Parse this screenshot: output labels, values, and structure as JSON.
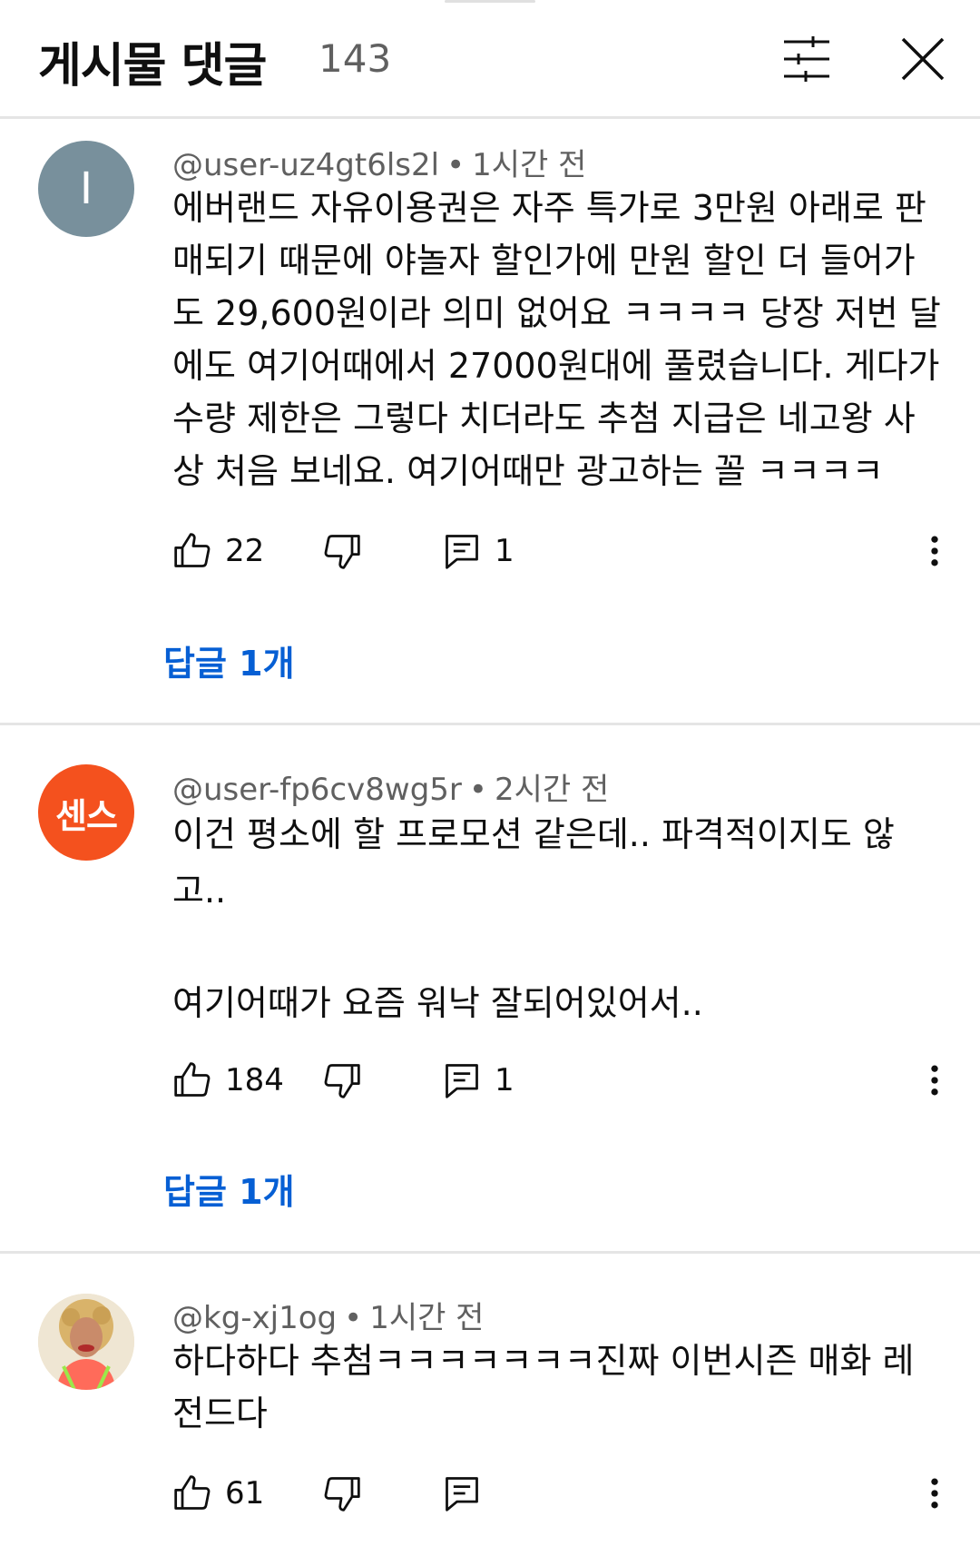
{
  "header": {
    "title": "게시물 댓글",
    "count": "143"
  },
  "comments": [
    {
      "avatar_letter": "I",
      "avatar_color": "#78909c",
      "username": "@user-uz4gt6ls2l",
      "time": "1시간 전",
      "text": "에버랜드 자유이용권은 자주 특가로 3만원 아래로 판매되기 때문에 야놀자 할인가에 만원 할인 더 들어가도 29,600원이라 의미 없어요 ㅋㅋㅋㅋ 당장 저번 달에도 여기어때에서 27000원대에 풀렸습니다. 게다가 수량 제한은 그렇다 치더라도 추첨 지급은 네고왕 사상 처음 보네요. 여기어때만 광고하는 꼴 ㅋㅋㅋㅋ",
      "likes": "22",
      "reply_count": "1",
      "replies_label": "답글 1개"
    },
    {
      "avatar_text": "센스",
      "avatar_color": "#f4511e",
      "username": "@user-fp6cv8wg5r",
      "time": "2시간 전",
      "text": "이건 평소에 할 프로모션 같은데.. 파격적이지도 않고..\n\n여기어때가 요즘 워낙 잘되어있어서..",
      "likes": "184",
      "reply_count": "1",
      "replies_label": "답글 1개"
    },
    {
      "avatar_type": "photo",
      "username": "@kg-xj1og",
      "time": "1시간 전",
      "text": "하다하다 추첨ㅋㅋㅋㅋㅋㅋㅋ진짜 이번시즌 매화 레전드다",
      "likes": "61"
    }
  ],
  "icons": {
    "filter": "tune-icon",
    "close": "close-icon",
    "like": "thumb-up-icon",
    "dislike": "thumb-down-icon",
    "reply": "comment-icon",
    "more": "more-vert-icon"
  },
  "colors": {
    "link": "#065fd4",
    "meta": "#606060"
  }
}
